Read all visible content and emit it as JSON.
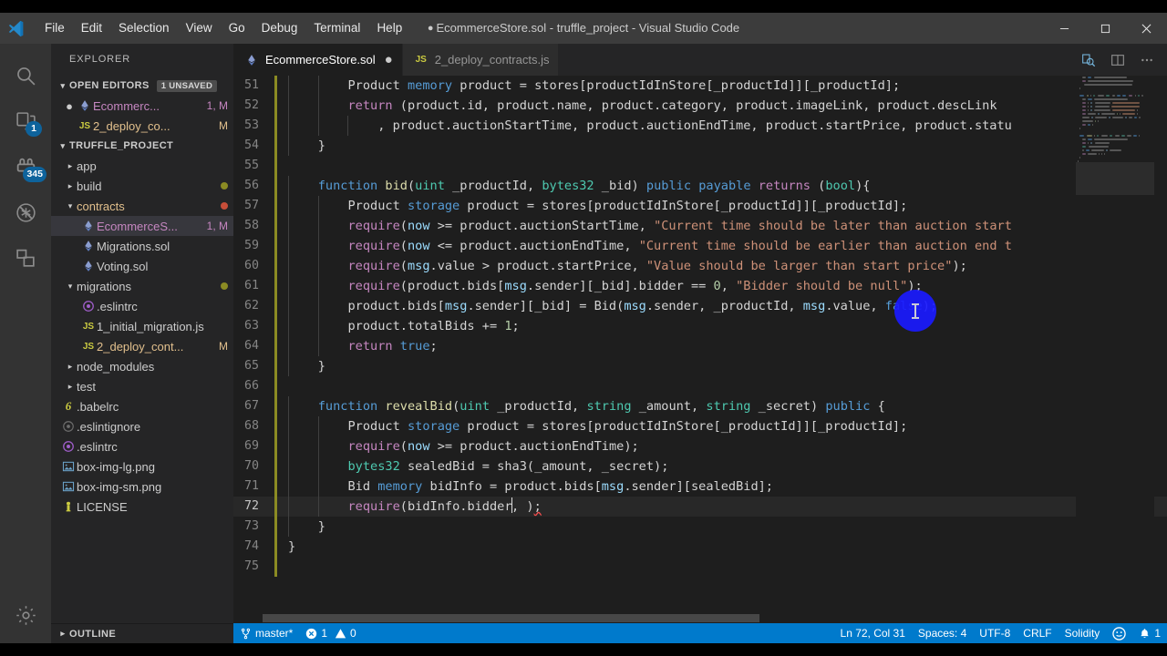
{
  "window": {
    "title_dot": "●",
    "title": "EcommerceStore.sol - truffle_project - Visual Studio Code",
    "minimize": "minimize-icon",
    "maximize": "maximize-icon",
    "close": "close-icon"
  },
  "menubar": {
    "items": [
      {
        "label": "File"
      },
      {
        "label": "Edit"
      },
      {
        "label": "Selection"
      },
      {
        "label": "View"
      },
      {
        "label": "Go"
      },
      {
        "label": "Debug"
      },
      {
        "label": "Terminal"
      },
      {
        "label": "Help"
      }
    ]
  },
  "activitybar": {
    "items": [
      {
        "name": "search-icon",
        "badge": ""
      },
      {
        "name": "source-control-icon",
        "badge": "1"
      },
      {
        "name": "extensions-icon",
        "badge": "345"
      },
      {
        "name": "debug-disabled-icon",
        "badge": ""
      },
      {
        "name": "remote-explorer-icon",
        "badge": ""
      }
    ],
    "bottom": [
      {
        "name": "gear-icon",
        "badge": ""
      }
    ]
  },
  "sidebar": {
    "title": "EXPLORER",
    "open_editors": {
      "label": "OPEN EDITORS",
      "badge": "1 UNSAVED",
      "items": [
        {
          "icon": "solidity-icon",
          "label": "Ecommerc...",
          "status": "1, M",
          "dirty": true,
          "modified": true
        },
        {
          "icon": "js-icon",
          "label": "2_deploy_co...",
          "status": "M",
          "dirty": false,
          "modified": false
        }
      ]
    },
    "project": {
      "label": "TRUFFLE_PROJECT",
      "items": [
        {
          "icon": "folder-icon",
          "label": "app",
          "indent": 1,
          "expanded": false,
          "status": "",
          "dot": ""
        },
        {
          "icon": "folder-icon",
          "label": "build",
          "indent": 1,
          "expanded": false,
          "status": "",
          "dot": "#8b8b23"
        },
        {
          "icon": "folder-icon",
          "label": "contracts",
          "indent": 1,
          "expanded": true,
          "status": "",
          "dot": "#c74e39",
          "color": "#e2c08d"
        },
        {
          "icon": "solidity-icon",
          "label": "EcommerceS...",
          "indent": 2,
          "status": "1, M",
          "selected": true,
          "color": "#c586c0"
        },
        {
          "icon": "solidity-icon",
          "label": "Migrations.sol",
          "indent": 2,
          "status": "",
          "dot": ""
        },
        {
          "icon": "solidity-icon",
          "label": "Voting.sol",
          "indent": 2,
          "status": "",
          "dot": ""
        },
        {
          "icon": "folder-icon",
          "label": "migrations",
          "indent": 1,
          "expanded": true,
          "status": "",
          "dot": "#8b8b23"
        },
        {
          "icon": "eslint-icon",
          "label": ".eslintrc",
          "indent": 2,
          "status": "",
          "dot": ""
        },
        {
          "icon": "js-icon",
          "label": "1_initial_migration.js",
          "indent": 2,
          "status": "",
          "dot": ""
        },
        {
          "icon": "js-icon",
          "label": "2_deploy_cont...",
          "indent": 2,
          "status": "M",
          "dot": "",
          "color": "#e2c08d"
        },
        {
          "icon": "folder-icon",
          "label": "node_modules",
          "indent": 1,
          "expanded": false,
          "status": "",
          "dot": ""
        },
        {
          "icon": "folder-icon",
          "label": "test",
          "indent": 1,
          "expanded": false,
          "status": "",
          "dot": ""
        },
        {
          "icon": "babel-icon",
          "label": ".babelrc",
          "indent": 1,
          "status": "",
          "dot": ""
        },
        {
          "icon": "eslintignore-icon",
          "label": ".eslintignore",
          "indent": 1,
          "status": "",
          "dot": ""
        },
        {
          "icon": "eslint-icon",
          "label": ".eslintrc",
          "indent": 1,
          "status": "",
          "dot": ""
        },
        {
          "icon": "image-icon",
          "label": "box-img-lg.png",
          "indent": 1,
          "status": "",
          "dot": ""
        },
        {
          "icon": "image-icon",
          "label": "box-img-sm.png",
          "indent": 1,
          "status": "",
          "dot": ""
        },
        {
          "icon": "license-icon",
          "label": "LICENSE",
          "indent": 1,
          "status": "",
          "dot": ""
        }
      ]
    },
    "outline": {
      "label": "OUTLINE"
    }
  },
  "tabs": {
    "items": [
      {
        "icon": "solidity-icon",
        "label": "EcommerceStore.sol",
        "active": true,
        "dirty": "●"
      },
      {
        "icon": "js-icon",
        "label": "2_deploy_contracts.js",
        "active": false,
        "dirty": ""
      }
    ],
    "actions": [
      {
        "name": "open-changes-icon"
      },
      {
        "name": "split-editor-icon"
      },
      {
        "name": "more-actions-icon"
      }
    ]
  },
  "editor": {
    "first_line_number": 51,
    "lines": [
      {
        "n": 51,
        "indent_guides": 2,
        "tokens": [
          {
            "t": "        ",
            "c": "plain"
          },
          {
            "t": "Product ",
            "c": "plain"
          },
          {
            "t": "memory",
            "c": "blue"
          },
          {
            "t": " product = stores[productIdInStore[_productId]][_productId];",
            "c": "plain"
          }
        ]
      },
      {
        "n": 52,
        "indent_guides": 2,
        "tokens": [
          {
            "t": "        ",
            "c": "plain"
          },
          {
            "t": "return",
            "c": "ctl"
          },
          {
            "t": " (product.id, product.name, product.category, product.imageLink, product.descLink",
            "c": "plain"
          }
        ]
      },
      {
        "n": 53,
        "indent_guides": 3,
        "tokens": [
          {
            "t": "            , product.auctionStartTime, product.auctionEndTime, product.startPrice, product.statu",
            "c": "plain"
          }
        ]
      },
      {
        "n": 54,
        "indent_guides": 1,
        "tokens": [
          {
            "t": "    }",
            "c": "plain"
          }
        ]
      },
      {
        "n": 55,
        "indent_guides": 0,
        "tokens": []
      },
      {
        "n": 56,
        "indent_guides": 1,
        "tokens": [
          {
            "t": "    ",
            "c": "plain"
          },
          {
            "t": "function",
            "c": "blue"
          },
          {
            "t": " ",
            "c": "plain"
          },
          {
            "t": "bid",
            "c": "fn"
          },
          {
            "t": "(",
            "c": "plain"
          },
          {
            "t": "uint",
            "c": "type"
          },
          {
            "t": " _productId, ",
            "c": "plain"
          },
          {
            "t": "bytes32",
            "c": "type"
          },
          {
            "t": " _bid) ",
            "c": "plain"
          },
          {
            "t": "public",
            "c": "blue"
          },
          {
            "t": " ",
            "c": "plain"
          },
          {
            "t": "payable",
            "c": "blue"
          },
          {
            "t": " ",
            "c": "plain"
          },
          {
            "t": "returns",
            "c": "ctl"
          },
          {
            "t": " (",
            "c": "plain"
          },
          {
            "t": "bool",
            "c": "type"
          },
          {
            "t": "){",
            "c": "plain"
          }
        ]
      },
      {
        "n": 57,
        "indent_guides": 2,
        "tokens": [
          {
            "t": "        Product ",
            "c": "plain"
          },
          {
            "t": "storage",
            "c": "blue"
          },
          {
            "t": " product = stores[productIdInStore[_productId]][_productId];",
            "c": "plain"
          }
        ]
      },
      {
        "n": 58,
        "indent_guides": 2,
        "tokens": [
          {
            "t": "        ",
            "c": "plain"
          },
          {
            "t": "require",
            "c": "ctl"
          },
          {
            "t": "(",
            "c": "plain"
          },
          {
            "t": "now",
            "c": "var"
          },
          {
            "t": " >= product.auctionStartTime, ",
            "c": "plain"
          },
          {
            "t": "\"Current time should be later than auction start",
            "c": "str"
          }
        ]
      },
      {
        "n": 59,
        "indent_guides": 2,
        "tokens": [
          {
            "t": "        ",
            "c": "plain"
          },
          {
            "t": "require",
            "c": "ctl"
          },
          {
            "t": "(",
            "c": "plain"
          },
          {
            "t": "now",
            "c": "var"
          },
          {
            "t": " <= product.auctionEndTime, ",
            "c": "plain"
          },
          {
            "t": "\"Current time should be earlier than auction end t",
            "c": "str"
          }
        ]
      },
      {
        "n": 60,
        "indent_guides": 2,
        "tokens": [
          {
            "t": "        ",
            "c": "plain"
          },
          {
            "t": "require",
            "c": "ctl"
          },
          {
            "t": "(",
            "c": "plain"
          },
          {
            "t": "msg",
            "c": "var"
          },
          {
            "t": ".value > product.startPrice, ",
            "c": "plain"
          },
          {
            "t": "\"Value should be larger than start price\"",
            "c": "str"
          },
          {
            "t": ");",
            "c": "plain"
          }
        ]
      },
      {
        "n": 61,
        "indent_guides": 2,
        "tokens": [
          {
            "t": "        ",
            "c": "plain"
          },
          {
            "t": "require",
            "c": "ctl"
          },
          {
            "t": "(product.bids[",
            "c": "plain"
          },
          {
            "t": "msg",
            "c": "var"
          },
          {
            "t": ".sender][_bid].bidder == ",
            "c": "plain"
          },
          {
            "t": "0",
            "c": "num"
          },
          {
            "t": ", ",
            "c": "plain"
          },
          {
            "t": "\"Bidder should be null\"",
            "c": "str"
          },
          {
            "t": ");",
            "c": "plain"
          }
        ]
      },
      {
        "n": 62,
        "indent_guides": 2,
        "tokens": [
          {
            "t": "        product.bids[",
            "c": "plain"
          },
          {
            "t": "msg",
            "c": "var"
          },
          {
            "t": ".sender][_bid] = Bid(",
            "c": "plain"
          },
          {
            "t": "msg",
            "c": "var"
          },
          {
            "t": ".sender, _productId, ",
            "c": "plain"
          },
          {
            "t": "msg",
            "c": "var"
          },
          {
            "t": ".value, ",
            "c": "plain"
          },
          {
            "t": "false",
            "c": "blue"
          },
          {
            "t": ");",
            "c": "plain"
          }
        ]
      },
      {
        "n": 63,
        "indent_guides": 2,
        "tokens": [
          {
            "t": "        product.totalBids += ",
            "c": "plain"
          },
          {
            "t": "1",
            "c": "num"
          },
          {
            "t": ";",
            "c": "plain"
          }
        ]
      },
      {
        "n": 64,
        "indent_guides": 2,
        "tokens": [
          {
            "t": "        ",
            "c": "plain"
          },
          {
            "t": "return",
            "c": "ctl"
          },
          {
            "t": " ",
            "c": "plain"
          },
          {
            "t": "true",
            "c": "blue"
          },
          {
            "t": ";",
            "c": "plain"
          }
        ]
      },
      {
        "n": 65,
        "indent_guides": 1,
        "tokens": [
          {
            "t": "    }",
            "c": "plain"
          }
        ]
      },
      {
        "n": 66,
        "indent_guides": 0,
        "tokens": []
      },
      {
        "n": 67,
        "indent_guides": 1,
        "tokens": [
          {
            "t": "    ",
            "c": "plain"
          },
          {
            "t": "function",
            "c": "blue"
          },
          {
            "t": " ",
            "c": "plain"
          },
          {
            "t": "revealBid",
            "c": "fn"
          },
          {
            "t": "(",
            "c": "plain"
          },
          {
            "t": "uint",
            "c": "type"
          },
          {
            "t": " _productId, ",
            "c": "plain"
          },
          {
            "t": "string",
            "c": "type"
          },
          {
            "t": " _amount, ",
            "c": "plain"
          },
          {
            "t": "string",
            "c": "type"
          },
          {
            "t": " _secret) ",
            "c": "plain"
          },
          {
            "t": "public",
            "c": "blue"
          },
          {
            "t": " {",
            "c": "plain"
          }
        ]
      },
      {
        "n": 68,
        "indent_guides": 2,
        "tokens": [
          {
            "t": "        Product ",
            "c": "plain"
          },
          {
            "t": "storage",
            "c": "blue"
          },
          {
            "t": " product = stores[productIdInStore[_productId]][_productId];",
            "c": "plain"
          }
        ]
      },
      {
        "n": 69,
        "indent_guides": 2,
        "tokens": [
          {
            "t": "        ",
            "c": "plain"
          },
          {
            "t": "require",
            "c": "ctl"
          },
          {
            "t": "(",
            "c": "plain"
          },
          {
            "t": "now",
            "c": "var"
          },
          {
            "t": " >= product.auctionEndTime);",
            "c": "plain"
          }
        ]
      },
      {
        "n": 70,
        "indent_guides": 2,
        "tokens": [
          {
            "t": "        ",
            "c": "plain"
          },
          {
            "t": "bytes32",
            "c": "type"
          },
          {
            "t": " sealedBid = sha3(_amount, _secret);",
            "c": "plain"
          }
        ]
      },
      {
        "n": 71,
        "indent_guides": 2,
        "tokens": [
          {
            "t": "        Bid ",
            "c": "plain"
          },
          {
            "t": "memory",
            "c": "blue"
          },
          {
            "t": " bidInfo = product.bids[",
            "c": "plain"
          },
          {
            "t": "msg",
            "c": "var"
          },
          {
            "t": ".sender][sealedBid];",
            "c": "plain"
          }
        ]
      },
      {
        "n": 72,
        "indent_guides": 2,
        "current": true,
        "tokens": [
          {
            "t": "        ",
            "c": "plain"
          },
          {
            "t": "require",
            "c": "ctl"
          },
          {
            "t": "(bidInfo.bidder",
            "c": "plain"
          },
          {
            "t": "CURSOR",
            "c": "cursor"
          },
          {
            "t": ", ",
            "c": "plain"
          },
          {
            "t": ")",
            "c": "plain"
          },
          {
            "t": ";",
            "c": "plain",
            "err": true
          }
        ]
      },
      {
        "n": 73,
        "indent_guides": 1,
        "tokens": [
          {
            "t": "    }",
            "c": "plain"
          }
        ]
      },
      {
        "n": 74,
        "indent_guides": 0,
        "tokens": [
          {
            "t": "}",
            "c": "plain"
          }
        ]
      },
      {
        "n": 75,
        "indent_guides": 0,
        "tokens": []
      }
    ]
  },
  "statusbar": {
    "left": [
      {
        "name": "branch",
        "icon": "source-control-icon",
        "label": "master*"
      },
      {
        "name": "problems",
        "icon": "error-icon",
        "label": "1",
        "icon2": "warning-icon",
        "label2": "0"
      }
    ],
    "right": [
      {
        "name": "cursor-position",
        "label": "Ln 72, Col 31"
      },
      {
        "name": "indentation",
        "label": "Spaces: 4"
      },
      {
        "name": "encoding",
        "label": "UTF-8"
      },
      {
        "name": "eol",
        "label": "CRLF"
      },
      {
        "name": "language-mode",
        "label": "Solidity"
      },
      {
        "name": "feedback-smiley",
        "label": ""
      },
      {
        "name": "notifications",
        "label": "1"
      }
    ]
  },
  "colors": {
    "accent": "#007acc",
    "titlebar": "#3c3c3c",
    "activitybar": "#333333",
    "sidebar": "#252526",
    "editor": "#1e1e1e",
    "tab_active": "#1e1e1e",
    "tab_inactive": "#2d2d2d",
    "modified_gutter": "#8b8b23",
    "error": "#f14c4c",
    "cursor_blob": "#1a1aff"
  }
}
